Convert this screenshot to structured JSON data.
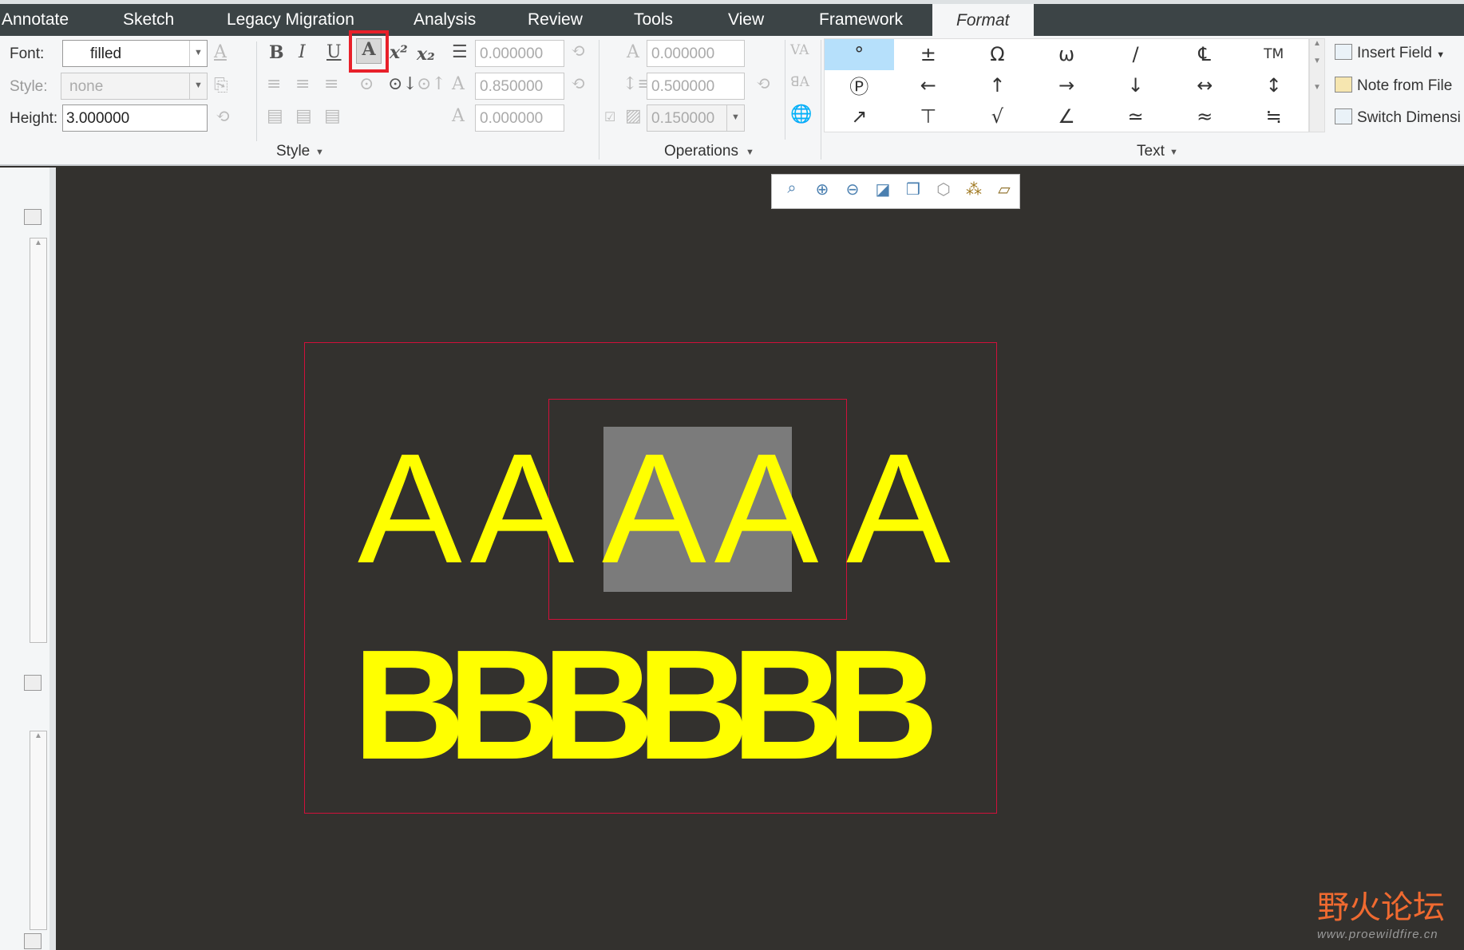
{
  "menu": {
    "tabs": [
      "Annotate",
      "Sketch",
      "Legacy Migration",
      "Analysis",
      "Review",
      "Tools",
      "View",
      "Framework",
      "Format"
    ],
    "active": "Format"
  },
  "ribbon": {
    "font_label": "Font:",
    "font_value": "filled",
    "style_label": "Style:",
    "style_value": "none",
    "height_label": "Height:",
    "height_value": "3.000000",
    "bold": "B",
    "italic": "I",
    "underline": "U",
    "filled_toggle": "A",
    "superscript": "x²",
    "subscript": "x₂",
    "slant_value": "0.000000",
    "width_factor_value": "0.850000",
    "thickness_value": "0.000000",
    "style_group": "Style",
    "char_spacing_value": "0.000000",
    "line_spacing_value": "0.500000",
    "frame_offset_value": "0.150000",
    "operations_group": "Operations",
    "symbols": [
      "°",
      "±",
      "Ω",
      "ω",
      "/",
      "℄",
      "TM",
      "Ⓟ",
      "←",
      "↑",
      "→",
      "↓",
      "↔",
      "↕",
      "↗",
      "⊤",
      "√",
      "∠",
      "≃",
      "≈",
      "≒"
    ],
    "text_group": "Text",
    "insert_field": "Insert Field",
    "note_from_file": "Note from File",
    "switch_dimension": "Switch Dimensi"
  },
  "canvas": {
    "line1_left": "AA",
    "line1_mid": "AA",
    "line1_right": "A",
    "line2": "BBBBBB",
    "text_color": "#ffff00",
    "frame_color": "#d0103a"
  },
  "watermark": {
    "cn": "野火论坛",
    "url": "www.proewildfire.cn"
  }
}
